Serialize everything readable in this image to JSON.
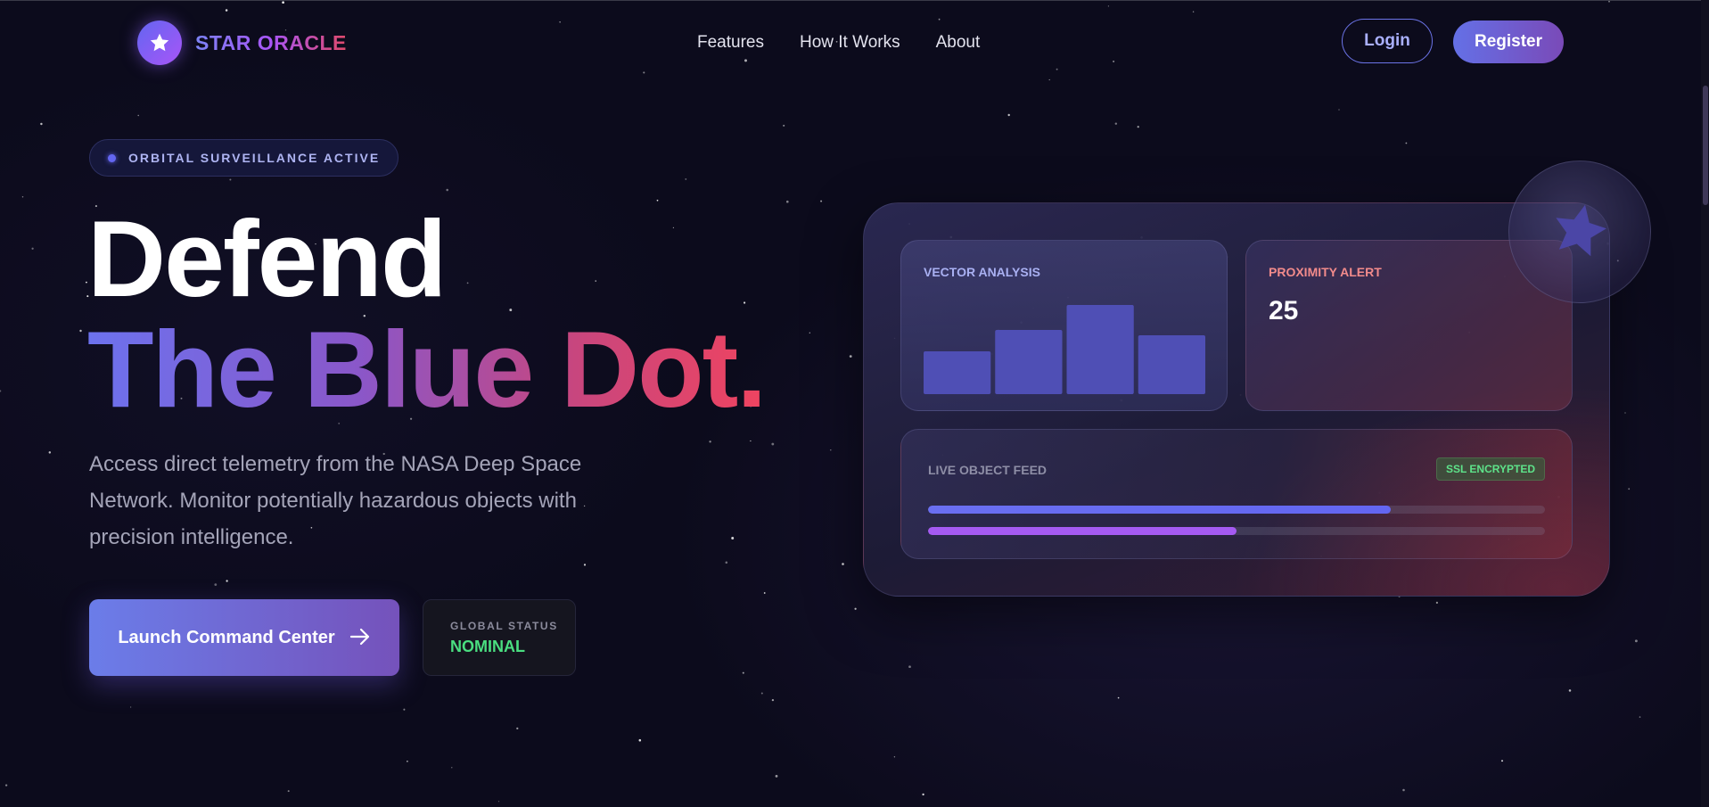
{
  "brand": {
    "name": "STAR ORACLE",
    "icon": "star-icon"
  },
  "nav": {
    "links": [
      {
        "label": "Features"
      },
      {
        "label": "How It Works"
      },
      {
        "label": "About"
      }
    ],
    "login_label": "Login",
    "register_label": "Register"
  },
  "hero": {
    "status_pill": "ORBITAL SURVEILLANCE ACTIVE",
    "headline_line1": "Defend",
    "headline_line2": "The Blue Dot.",
    "subtitle": "Access direct telemetry from the NASA Deep Space Network. Monitor potentially hazardous objects with precision intelligence.",
    "cta_label": "Launch Command Center",
    "cta_icon": "arrow-right-icon",
    "global_status_label": "GLOBAL STATUS",
    "global_status_value": "NOMINAL"
  },
  "dashboard": {
    "vector_analysis": {
      "title": "VECTOR ANALYSIS",
      "bar_levels": [
        0.48,
        0.72,
        1.0,
        0.66
      ],
      "bar_color": "#4f4fb5"
    },
    "proximity_alert": {
      "title": "PROXIMITY ALERT",
      "value": "25"
    },
    "live_feed": {
      "title": "LIVE OBJECT FEED",
      "badge": "SSL ENCRYPTED",
      "progress": [
        0.75,
        0.5
      ]
    },
    "orb_icon": "star-icon"
  },
  "colors": {
    "accent": "#6366f1",
    "purple": "#a855f7",
    "pink": "#ef4460",
    "success": "#4ade80",
    "background": "#0c0b1c"
  }
}
